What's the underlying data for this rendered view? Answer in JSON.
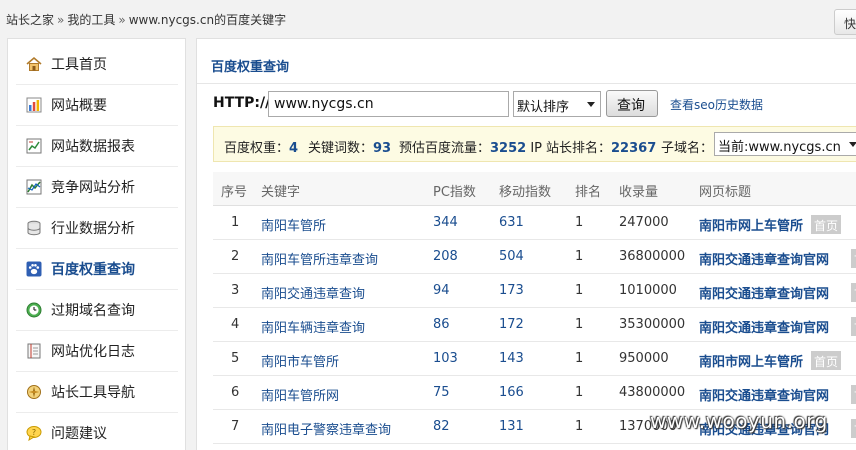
{
  "breadcrumb": {
    "items": [
      "站长之家",
      "我的工具",
      "www.nycgs.cn的百度关键字"
    ],
    "separator": "»"
  },
  "header": {
    "quick_button": "快"
  },
  "sidebar": {
    "items": [
      {
        "label": "工具首页",
        "icon": "home-icon"
      },
      {
        "label": "网站概要",
        "icon": "bar-chart-icon"
      },
      {
        "label": "网站数据报表",
        "icon": "report-icon"
      },
      {
        "label": "竞争网站分析",
        "icon": "compare-chart-icon"
      },
      {
        "label": "行业数据分析",
        "icon": "database-icon"
      },
      {
        "label": "百度权重查询",
        "icon": "paw-icon",
        "active": true
      },
      {
        "label": "过期域名查询",
        "icon": "clock-icon"
      },
      {
        "label": "网站优化日志",
        "icon": "notebook-icon"
      },
      {
        "label": "站长工具导航",
        "icon": "compass-icon"
      },
      {
        "label": "问题建议",
        "icon": "speech-bubble-icon"
      }
    ]
  },
  "main": {
    "title": "百度权重查询",
    "query": {
      "label": "HTTP://",
      "value": "www.nycgs.cn",
      "sort_option": "默认排序",
      "submit_label": "查询",
      "history_link": "查看seo历史数据"
    },
    "stats": {
      "weight_label": "百度权重：",
      "weight": "4",
      "keywords_label": "关键词数：",
      "keywords": "93",
      "traffic_label": "预估百度流量：",
      "traffic": "3252",
      "traffic_unit": "IP",
      "rank_label": "站长排名：",
      "rank": "22367",
      "subdomain_label": "子域名：",
      "subdomain_value": "当前:www.nycgs.cn"
    },
    "table": {
      "headers": [
        "序号",
        "关键字",
        "PC指数",
        "移动指数",
        "排名",
        "收录量",
        "网页标题"
      ],
      "rows": [
        {
          "no": "1",
          "keyword": "南阳车管所",
          "pc": "344",
          "mobile": "631",
          "rank": "1",
          "indexed": "247000",
          "title": "南阳市网上车管所",
          "badge": "首页"
        },
        {
          "no": "2",
          "keyword": "南阳车管所违章查询",
          "pc": "208",
          "mobile": "504",
          "rank": "1",
          "indexed": "36800000",
          "title": "南阳交通违章查询官网",
          "badge": "首页"
        },
        {
          "no": "3",
          "keyword": "南阳交通违章查询",
          "pc": "94",
          "mobile": "173",
          "rank": "1",
          "indexed": "1010000",
          "title": "南阳交通违章查询官网",
          "badge": "首页"
        },
        {
          "no": "4",
          "keyword": "南阳车辆违章查询",
          "pc": "86",
          "mobile": "172",
          "rank": "1",
          "indexed": "35300000",
          "title": "南阳交通违章查询官网",
          "badge": "首页"
        },
        {
          "no": "5",
          "keyword": "南阳市车管所",
          "pc": "103",
          "mobile": "143",
          "rank": "1",
          "indexed": "950000",
          "title": "南阳市网上车管所",
          "badge": "首页"
        },
        {
          "no": "6",
          "keyword": "南阳车管所网",
          "pc": "75",
          "mobile": "166",
          "rank": "1",
          "indexed": "43800000",
          "title": "南阳交通违章查询官网",
          "badge": "首页"
        },
        {
          "no": "7",
          "keyword": "南阳电子警察违章查询",
          "pc": "82",
          "mobile": "131",
          "rank": "1",
          "indexed": "1370000",
          "title": "南阳交通违章查询官网",
          "badge": "首页"
        }
      ]
    }
  },
  "watermark": "www.wooyun.org"
}
